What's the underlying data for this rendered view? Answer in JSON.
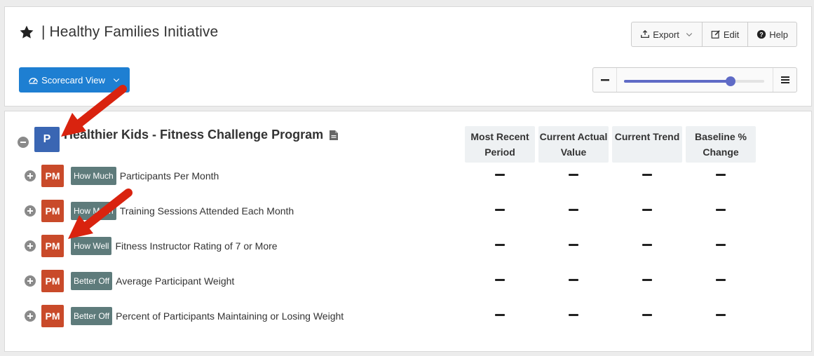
{
  "header": {
    "title": "| Healthy Families Initiative",
    "icon": "star-icon",
    "buttons": [
      {
        "label": "Export",
        "icon": "export-icon"
      },
      {
        "label": "Edit",
        "icon": "edit-icon"
      },
      {
        "label": "Help",
        "icon": "help-icon"
      }
    ]
  },
  "toolbar": {
    "view_label": "Scorecard View",
    "zoom_level": 0.76
  },
  "program": {
    "badge": "P",
    "title": "Healthier Kids - Fitness Challenge Program"
  },
  "columns": [
    "Most Recent Period",
    "Current Actual Value",
    "Current Trend",
    "Baseline % Change"
  ],
  "measures": [
    {
      "badge": "PM",
      "tag": "How Much",
      "name": "Participants Per Month",
      "values": [
        "—",
        "—",
        "—",
        "—"
      ]
    },
    {
      "badge": "PM",
      "tag": "How Much",
      "name": "Training Sessions Attended Each Month",
      "values": [
        "—",
        "—",
        "—",
        "—"
      ]
    },
    {
      "badge": "PM",
      "tag": "How Well",
      "name": "Fitness Instructor Rating of 7 or More",
      "values": [
        "—",
        "—",
        "—",
        "—"
      ]
    },
    {
      "badge": "PM",
      "tag": "Better Off",
      "name": "Average Participant Weight",
      "values": [
        "—",
        "—",
        "—",
        "—"
      ]
    },
    {
      "badge": "PM",
      "tag": "Better Off",
      "name": "Percent of Participants Maintaining or Losing Weight",
      "values": [
        "—",
        "—",
        "—",
        "—"
      ]
    }
  ],
  "colors": {
    "accent": "#1e7fd2",
    "program_badge": "#3a66b3",
    "measure_badge": "#c94a2a",
    "tag": "#5e7b7b",
    "slider": "#5f6bc6",
    "annotation_arrow": "#d9230f"
  }
}
